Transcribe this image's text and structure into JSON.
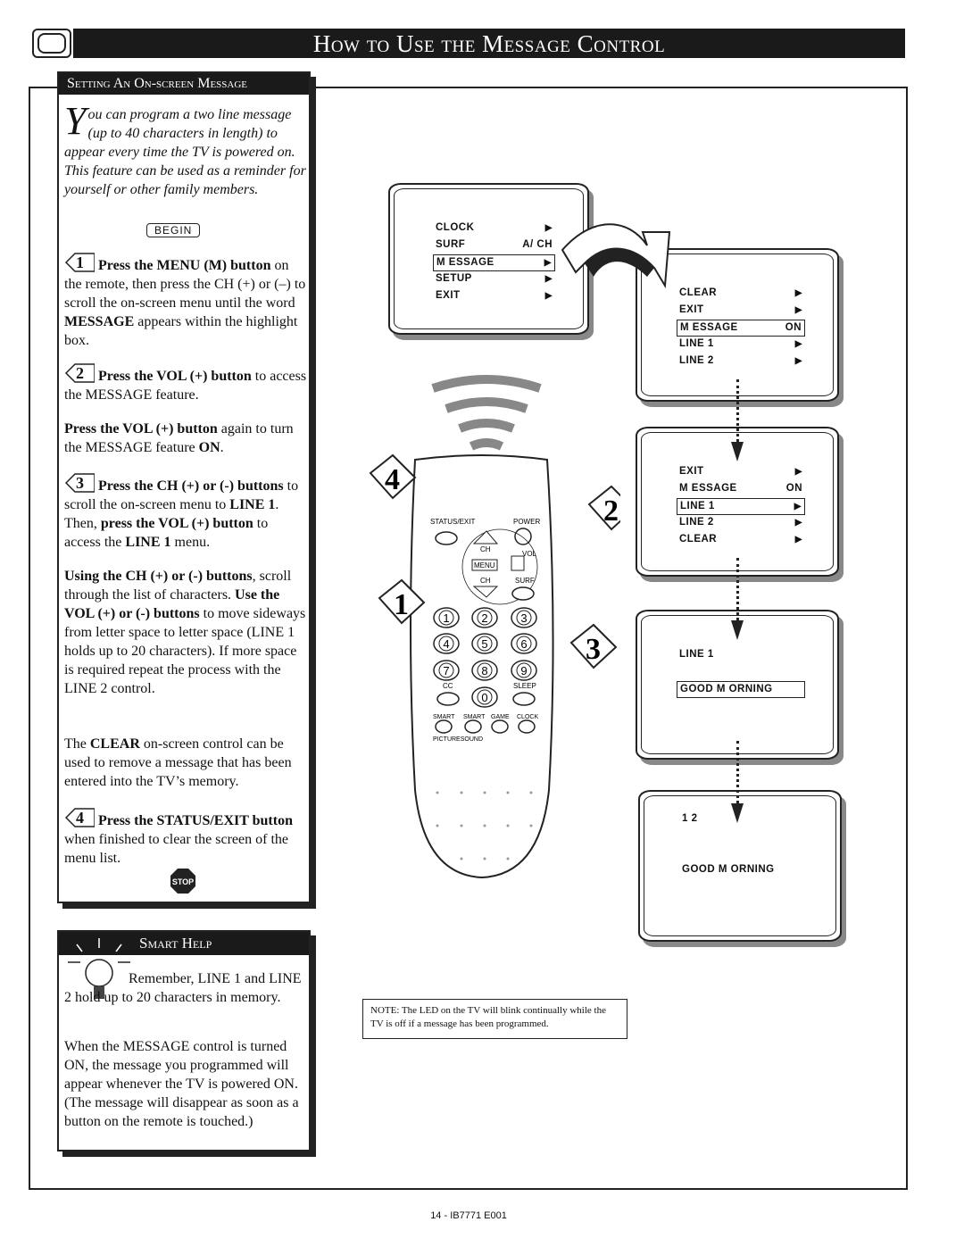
{
  "header": {
    "title": "How to Use the Message Control",
    "icon": "tv-icon"
  },
  "setting": {
    "title": "Setting An On-screen Message",
    "intro_dropcap": "Y",
    "intro": "ou can program a two line message (up to 40 characters in length) to appear every time the TV is powered on. This feature can be used as a reminder for yourself or other family members.",
    "begin": "BEGIN",
    "paragraphs": [
      {
        "step": "1",
        "segs": [
          [
            "Press the MENU (M) button",
            1
          ],
          [
            " on the remote, then press the CH (+) or (–) to scroll the on-screen menu until the word ",
            0
          ],
          [
            "MESSAGE",
            1
          ],
          [
            " appears within the highlight box.",
            0
          ]
        ]
      },
      {
        "step": "2",
        "segs": [
          [
            "Press the VOL (+) button",
            1
          ],
          [
            " to access the MESSAGE feature.",
            0
          ]
        ]
      },
      {
        "segs": [
          [
            "Press the VOL (+) button",
            1
          ],
          [
            " again to turn the MESSAGE feature ",
            0
          ],
          [
            "ON",
            1
          ],
          [
            ".",
            0
          ]
        ]
      },
      {
        "step": "3",
        "segs": [
          [
            "Press the CH (+) or (-) buttons",
            1
          ],
          [
            " to scroll the on-screen menu to ",
            0
          ],
          [
            "LINE 1",
            1
          ],
          [
            ". Then, ",
            0
          ],
          [
            "press the VOL (+) button",
            1
          ],
          [
            " to access the ",
            0
          ],
          [
            "LINE 1",
            1
          ],
          [
            " menu.",
            0
          ]
        ]
      },
      {
        "segs": [
          [
            "Using the CH (+) or (-) buttons",
            1
          ],
          [
            ", scroll through the list of characters. ",
            0
          ],
          [
            "Use the VOL (+) or (-) buttons",
            1
          ],
          [
            " to move sideways from letter space to letter space (LINE 1 holds up to 20 characters).  If more space is required repeat the process with the LINE 2 control.",
            0
          ]
        ]
      },
      {
        "segs": [
          [
            "The ",
            0
          ],
          [
            "CLEAR",
            1
          ],
          [
            " on-screen control can be used to remove a message that has been entered into the TV’s memory.",
            0
          ]
        ]
      },
      {
        "step": "4",
        "segs": [
          [
            "Press the STATUS/EXIT button",
            1
          ],
          [
            " when finished to clear the screen of the menu list.",
            0
          ]
        ]
      }
    ],
    "stop": "STOP"
  },
  "smart_help": {
    "title": "Smart Help",
    "icon": "lightbulb-icon",
    "p1": "Remember, LINE 1 and LINE 2 hold up to 20 characters in memory.",
    "p2": "When the MESSAGE control is turned ON, the message you programmed will appear whenever the TV is powered ON. (The message will disappear as soon as a button on the remote is touched.)"
  },
  "screens": [
    {
      "rows": [
        [
          "CLOCK",
          "▶"
        ],
        [
          "SURF",
          "A/ CH"
        ],
        [
          "M ESSAGE",
          "▶",
          true
        ],
        [
          "SETUP",
          "▶"
        ],
        [
          "EXIT",
          "▶"
        ]
      ]
    },
    {
      "rows": [
        [
          "CLEAR",
          "▶"
        ],
        [
          "EXIT",
          "▶"
        ],
        [
          "M ESSAGE",
          "ON",
          true
        ],
        [
          "LINE 1",
          "▶"
        ],
        [
          "LINE 2",
          "▶"
        ]
      ]
    },
    {
      "rows": [
        [
          "EXIT",
          "▶"
        ],
        [
          "M ESSAGE",
          "ON"
        ],
        [
          "LINE 1",
          "▶",
          true
        ],
        [
          "LINE 2",
          "▶"
        ],
        [
          "CLEAR",
          "▶"
        ]
      ]
    },
    {
      "rows": [
        [
          "LINE 1",
          ""
        ],
        [
          "",
          ""
        ],
        [
          "GOOD M ORNING",
          "",
          true
        ]
      ]
    },
    {
      "rows": [
        [
          "1 2",
          ""
        ],
        [
          "",
          ""
        ],
        [
          "",
          ""
        ],
        [
          "GOOD M ORNING",
          ""
        ]
      ]
    }
  ],
  "remote": {
    "labels": {
      "status_exit": "STATUS/EXIT",
      "power": "POWER",
      "ch": "CH",
      "menu": "MENU",
      "vol": "VOL",
      "surf": "SURF",
      "cc": "CC",
      "sleep": "SLEEP",
      "smart1": "SMART",
      "smart2": "SMART",
      "game": "GAME",
      "clock": "CLOCK",
      "picturesound": "PICTURESOUND"
    },
    "digits": [
      "1",
      "2",
      "3",
      "4",
      "5",
      "6",
      "7",
      "8",
      "9",
      "0"
    ],
    "callouts": [
      "1",
      "2",
      "3",
      "4"
    ]
  },
  "note": "NOTE: The LED on the TV will blink continually while the TV is off if a message has been programmed.",
  "footer": "14 - IB7771 E001"
}
